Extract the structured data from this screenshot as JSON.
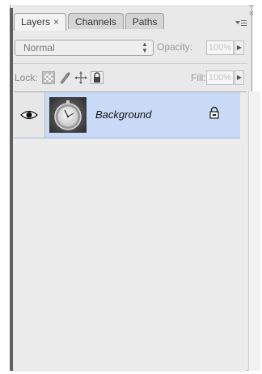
{
  "panel": {
    "tabs": [
      {
        "label": "Layers",
        "close": "×"
      },
      {
        "label": "Channels"
      },
      {
        "label": "Paths"
      }
    ],
    "window_controls": {
      "minimize": "–",
      "close": "×"
    },
    "menu_icon": "panel-menu-icon"
  },
  "controls": {
    "blend_mode": "Normal",
    "opacity_label": "Opacity:",
    "opacity_value": "100%",
    "lock_label": "Lock:",
    "fill_label": "Fill:",
    "fill_value": "100%",
    "lock_buttons": [
      "lock-transparent-pixels-icon",
      "lock-image-pixels-icon",
      "lock-position-icon",
      "lock-all-icon"
    ]
  },
  "layers": [
    {
      "name": "Background",
      "visible": true,
      "locked": true,
      "selected": true,
      "thumbnail": "pocket-watch-photo"
    }
  ],
  "colors": {
    "selection": "#c9daf6",
    "panel_bg": "#e9e9e9"
  }
}
